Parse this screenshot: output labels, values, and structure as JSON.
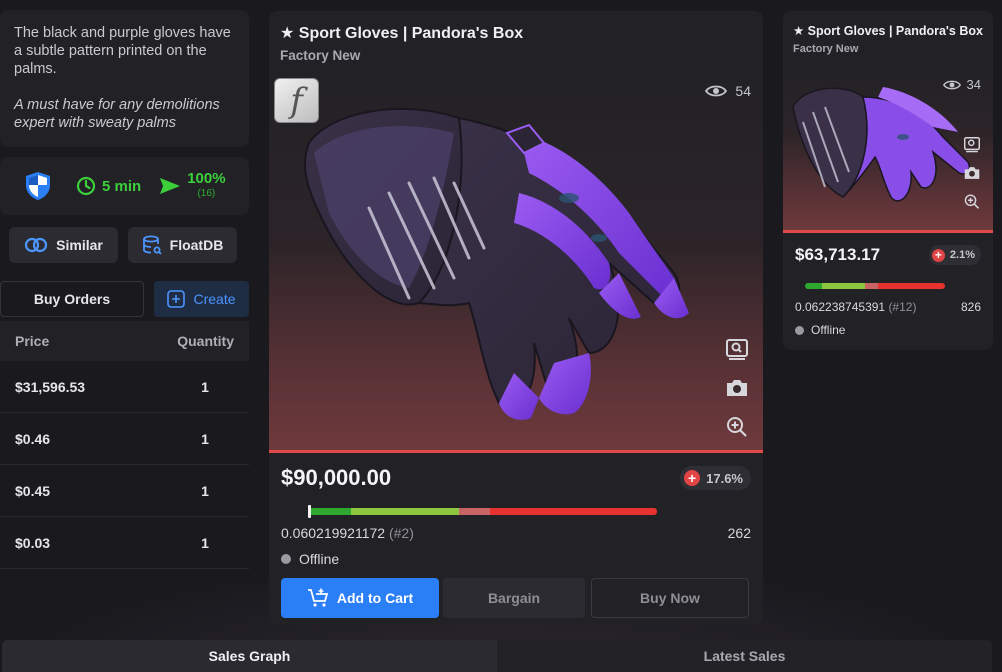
{
  "description": {
    "text1": "The black and purple gloves have a subtle pattern printed on the palms.",
    "text2": "A must have for any demolitions expert with sweaty palms"
  },
  "trade": {
    "time": "5 min",
    "rate": "100%",
    "rate_count": "(16)"
  },
  "links": {
    "similar": "Similar",
    "floatdb": "FloatDB"
  },
  "orders": {
    "tab_label": "Buy Orders",
    "create_label": "Create",
    "col_price": "Price",
    "col_quantity": "Quantity",
    "rows": [
      {
        "price": "$31,596.53",
        "quantity": "1"
      },
      {
        "price": "$0.46",
        "quantity": "1"
      },
      {
        "price": "$0.45",
        "quantity": "1"
      },
      {
        "price": "$0.03",
        "quantity": "1"
      }
    ]
  },
  "listing": {
    "title": "★ Sport Gloves | Pandora's Box",
    "condition": "Factory New",
    "stattrak_glyph": "f",
    "views": "54",
    "price": "$90,000.00",
    "change": "17.6%",
    "float": "0.060219921172",
    "float_rank": "(#2)",
    "pattern": "262",
    "status": "Offline",
    "add_to_cart": "Add to Cart",
    "bargain": "Bargain",
    "buy_now": "Buy Now",
    "float_level": 0.06
  },
  "side_listing": {
    "title": "★ Sport Gloves | Pandora's Box",
    "condition": "Factory New",
    "views": "34",
    "price": "$63,713.17",
    "change": "2.1%",
    "float": "0.062238745391",
    "float_rank": "(#12)",
    "pattern": "826",
    "status": "Offline"
  },
  "tabs": {
    "sales_graph": "Sales Graph",
    "latest_sales": "Latest Sales"
  },
  "colors": {
    "accent": "#2a7ef6",
    "positive": "#3ccf3c",
    "negative": "#e04444",
    "rarity_red": "#e14a4a"
  }
}
